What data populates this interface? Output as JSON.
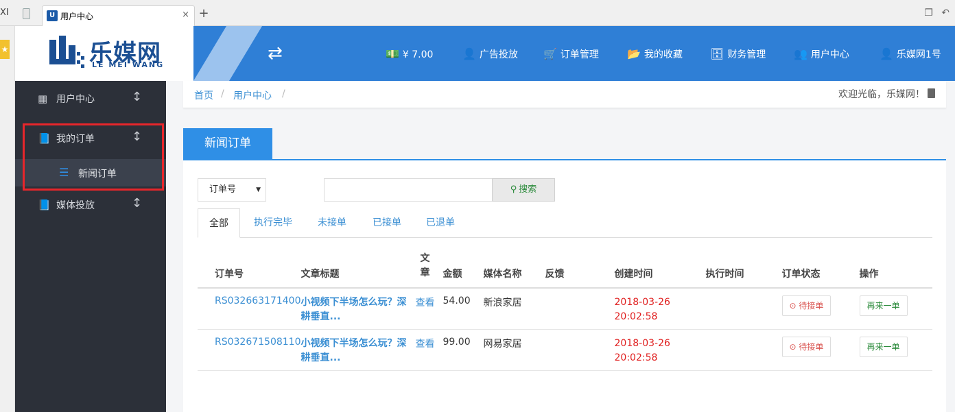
{
  "browser": {
    "left_stub": "XI",
    "tab_title": "用户中心",
    "favicon_text": "U",
    "close_glyph": "×",
    "newtab_glyph": "+"
  },
  "header": {
    "logo_cn": "乐媒网",
    "logo_en": "LE MEI WANG",
    "balance": "¥ 7.00",
    "nav": [
      "广告投放",
      "订单管理",
      "我的收藏",
      "财务管理",
      "用户中心",
      "乐媒网1号"
    ]
  },
  "sidebar": {
    "items": [
      {
        "label": "用户中心"
      },
      {
        "label": "我的订单"
      },
      {
        "label": "媒体投放"
      }
    ],
    "sub_item": "新闻订单"
  },
  "breadcrumb": {
    "items": [
      "首页",
      "用户中心"
    ],
    "sep": "/",
    "welcome": "欢迎光临，乐媒网！"
  },
  "panel": {
    "title": "新闻订单",
    "select_value": "订单号",
    "search_placeholder": "",
    "search_label": "搜索",
    "tabs": [
      "全部",
      "执行完毕",
      "未接单",
      "已接单",
      "已退单"
    ],
    "active_tab": "全部"
  },
  "table": {
    "headers": [
      "订单号",
      "文章标题",
      "文\n章",
      "金额",
      "媒体名称",
      "反馈",
      "创建时间",
      "执行时间",
      "订单状态",
      "操作"
    ],
    "rows": [
      {
        "id": "RS032663171400",
        "title": "小视频下半场怎么玩？深耕垂直...",
        "view": "查看",
        "amount": "54.00",
        "media": "新浪家居",
        "feedback": "",
        "created": "2018-03-26 20:02:58",
        "executed": "",
        "status": "待接单",
        "action": "再来一单"
      },
      {
        "id": "RS032671508110",
        "title": "小视频下半场怎么玩？深耕垂直...",
        "view": "查看",
        "amount": "99.00",
        "media": "网易家居",
        "feedback": "",
        "created": "2018-03-26 20:02:58",
        "executed": "",
        "status": "待接单",
        "action": "再来一单"
      }
    ]
  },
  "colors": {
    "header_blue": "#2f7fd6",
    "sidebar_dark": "#2c3039",
    "link_blue": "#3b8fd3",
    "date_red": "#e02020",
    "highlight_red": "#e8262b"
  }
}
